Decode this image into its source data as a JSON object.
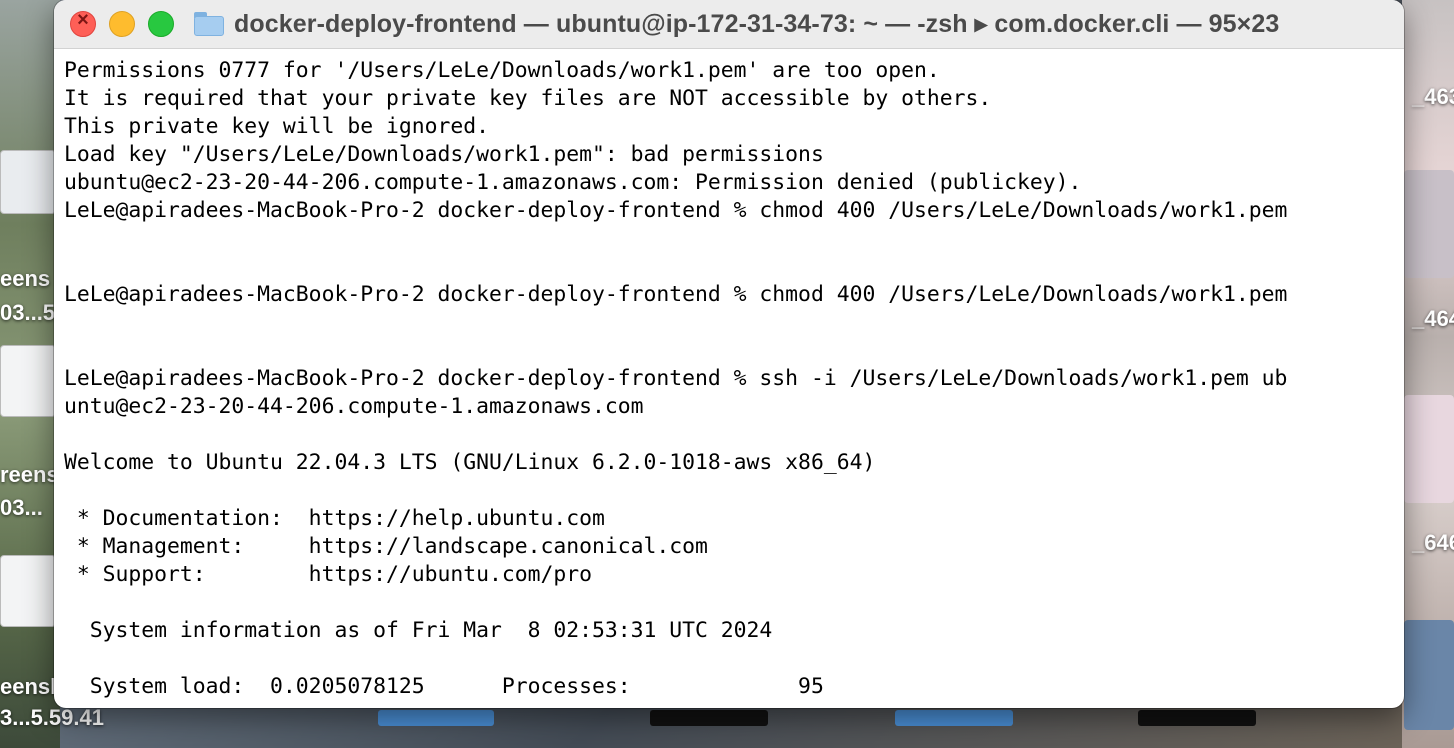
{
  "window": {
    "title": "docker-deploy-frontend — ubuntu@ip-172-31-34-73: ~ — -zsh ▸ com.docker.cli — 95×23"
  },
  "terminal": {
    "lines": [
      "Permissions 0777 for '/Users/LeLe/Downloads/work1.pem' are too open.",
      "It is required that your private key files are NOT accessible by others.",
      "This private key will be ignored.",
      "Load key \"/Users/LeLe/Downloads/work1.pem\": bad permissions",
      "ubuntu@ec2-23-20-44-206.compute-1.amazonaws.com: Permission denied (publickey).",
      "LeLe@apiradees-MacBook-Pro-2 docker-deploy-frontend % chmod 400 /Users/LeLe/Downloads/work1.pem",
      "",
      "",
      "LeLe@apiradees-MacBook-Pro-2 docker-deploy-frontend % chmod 400 /Users/LeLe/Downloads/work1.pem",
      "",
      "",
      "LeLe@apiradees-MacBook-Pro-2 docker-deploy-frontend % ssh -i /Users/LeLe/Downloads/work1.pem ub",
      "untu@ec2-23-20-44-206.compute-1.amazonaws.com",
      "",
      "Welcome to Ubuntu 22.04.3 LTS (GNU/Linux 6.2.0-1018-aws x86_64)",
      "",
      " * Documentation:  https://help.ubuntu.com",
      " * Management:     https://landscape.canonical.com",
      " * Support:        https://ubuntu.com/pro",
      "",
      "  System information as of Fri Mar  8 02:53:31 UTC 2024",
      "",
      "  System load:  0.0205078125      Processes:             95"
    ]
  },
  "desktop": {
    "labels": [
      "eens",
      "03...5",
      "reens",
      "03...",
      "eensh",
      "3...5.59.41",
      "_463",
      "_464",
      "_646"
    ]
  }
}
